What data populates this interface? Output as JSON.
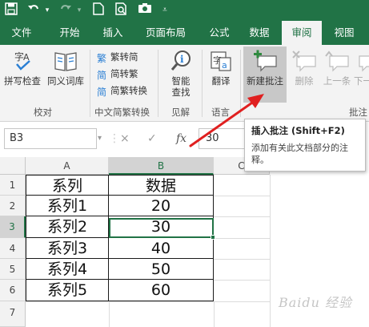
{
  "quick_access": {
    "save_icon": "save-icon",
    "undo_icon": "undo-icon",
    "redo_icon": "redo-icon",
    "new_icon": "new-file-icon",
    "preview_icon": "print-preview-icon",
    "camera_icon": "camera-icon",
    "more_icon": "customize-qat-icon"
  },
  "tabs": [
    "文件",
    "开始",
    "插入",
    "页面布局",
    "公式",
    "数据",
    "审阅",
    "视图"
  ],
  "active_tab": "审阅",
  "ribbon": {
    "proofing": {
      "spellcheck": "拼写检查",
      "thesaurus": "同义词库",
      "group": "校对"
    },
    "chinese_conversion": {
      "to_simplified": "繁转简",
      "to_traditional": "简转繁",
      "convert": "简繁转换",
      "group": "中文简繁转换"
    },
    "insights": {
      "smart_lookup_line1": "智能",
      "smart_lookup_line2": "查找",
      "group": "见解"
    },
    "language": {
      "translate": "翻译",
      "group": "语言"
    },
    "comments": {
      "new_comment": "新建批注",
      "delete": "删除",
      "previous": "上一条",
      "next": "下一",
      "group": "批注"
    }
  },
  "formula_bar": {
    "name_box": "B3",
    "cancel_icon": "×",
    "enter_icon": "✓",
    "fx_label": "fx",
    "value": "30"
  },
  "tooltip": {
    "title": "插入批注 (Shift+F2)",
    "description": "添加有关此文档部分的注释。"
  },
  "sheet": {
    "columns": [
      "A",
      "B",
      "C"
    ],
    "rows": [
      "1",
      "2",
      "3",
      "4",
      "5",
      "6",
      "7"
    ],
    "selected_cell": "B3",
    "data": [
      [
        "系列",
        "数据"
      ],
      [
        "系列1",
        "20"
      ],
      [
        "系列2",
        "30"
      ],
      [
        "系列3",
        "40"
      ],
      [
        "系列4",
        "50"
      ],
      [
        "系列5",
        "60"
      ]
    ]
  },
  "watermark": "Baidu 经验",
  "colors": {
    "excel_green": "#217346",
    "arrow_red": "#e02020",
    "highlight": "#c8c8c8"
  }
}
